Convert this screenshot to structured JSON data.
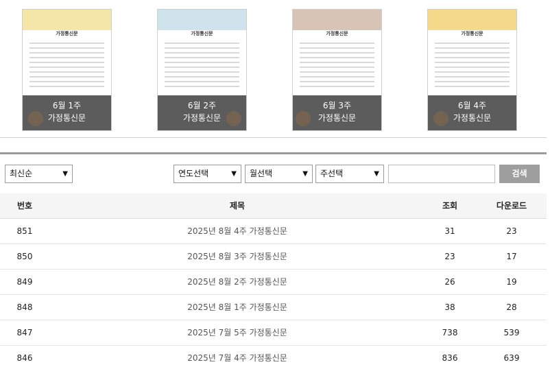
{
  "cards": [
    {
      "doc_title": "가정통신문",
      "week": "6월 1주",
      "label": "가정통신문",
      "accent": "#f3e6a8"
    },
    {
      "doc_title": "가정통신문",
      "week": "6월 2주",
      "label": "가정통신문",
      "accent": "#cfe3ec"
    },
    {
      "doc_title": "가정통신문",
      "week": "6월 3주",
      "label": "가정통신문",
      "accent": "#d8c4b4"
    },
    {
      "doc_title": "가정통신문",
      "week": "6월 4주",
      "label": "가정통신문",
      "accent": "#f4d98a"
    }
  ],
  "filters": {
    "sort": "최신순",
    "year": "연도선택",
    "month": "월선택",
    "week": "주선택",
    "search_value": "",
    "search_button": "검색"
  },
  "table": {
    "headers": {
      "num": "번호",
      "title": "제목",
      "views": "조회",
      "downloads": "다운로드"
    },
    "rows": [
      {
        "num": "851",
        "title": "2025년 8월 4주 가정통신문",
        "views": "31",
        "downloads": "23"
      },
      {
        "num": "850",
        "title": "2025년 8월 3주 가정통신문",
        "views": "23",
        "downloads": "17"
      },
      {
        "num": "849",
        "title": "2025년 8월 2주 가정통신문",
        "views": "26",
        "downloads": "19"
      },
      {
        "num": "848",
        "title": "2025년 8월 1주 가정통신문",
        "views": "38",
        "downloads": "28"
      },
      {
        "num": "847",
        "title": "2025년 7월 5주 가정통신문",
        "views": "738",
        "downloads": "539"
      },
      {
        "num": "846",
        "title": "2025년 7월 4주 가정통신문",
        "views": "836",
        "downloads": "639"
      }
    ]
  }
}
